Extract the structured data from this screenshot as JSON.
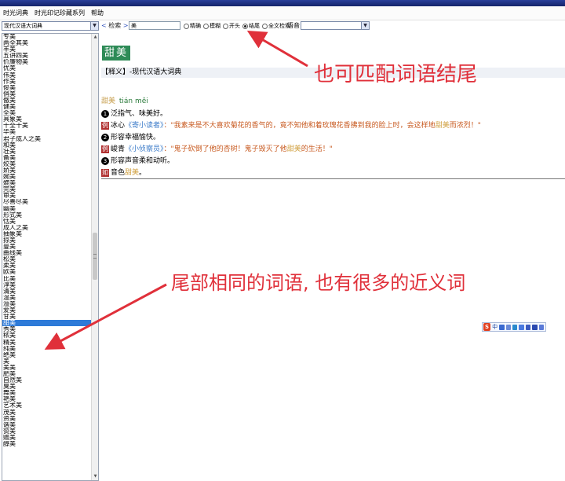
{
  "menu": [
    "时光词典",
    "时光印记珍藏系列",
    "帮助"
  ],
  "toolbar": {
    "dictionary": "现代汉语大词典",
    "search_label": "检索",
    "search_value": "美",
    "radios": [
      {
        "label": "精确",
        "checked": false
      },
      {
        "label": "模糊",
        "checked": false
      },
      {
        "label": "开头",
        "checked": false
      },
      {
        "label": "结尾",
        "checked": true
      },
      {
        "label": "全文检索",
        "checked": false
      }
    ],
    "voice_label": "语音"
  },
  "word_list": [
    "专美",
    "两全其美",
    "丰美",
    "五讲四美",
    "价廉物美",
    "优美",
    "伟美",
    "作美",
    "俊美",
    "俏美",
    "傲美",
    "健美",
    "全美",
    "具象美",
    "十全十美",
    "华美",
    "君子成人之美",
    "和美",
    "壮美",
    "备美",
    "姣美",
    "娇美",
    "婉美",
    "媲美",
    "完美",
    "审美",
    "尽善尽美",
    "幽美",
    "形式美",
    "恬美",
    "成人之美",
    "抽象美",
    "掠美",
    "曼美",
    "曲线美",
    "松美",
    "柔美",
    "欧美",
    "比美",
    "淳美",
    "清美",
    "温美",
    "溢美",
    "爱美",
    "甘美",
    "甜美",
    "秀美",
    "秾美",
    "精美",
    "纯美",
    "绝美",
    "美",
    "美美",
    "肥美",
    "自然美",
    "臭美",
    "舞美",
    "艳美",
    "艺术美",
    "茂美",
    "资美",
    "谐美",
    "赞美",
    "赡美",
    "醇美"
  ],
  "selected_word": "甜美",
  "entry": {
    "headword": "甜美",
    "source_tag": "【释义】",
    "source_text": "-现代汉语大词典",
    "word": "甜美",
    "pinyin": "tián měi",
    "sense1_num": "❶",
    "sense1": "泛指气、味美好。",
    "ex_tag": "例",
    "ex1_author": "冰心",
    "ex1_book": "《寄小读者》",
    "ex1_pre": "：\"我素来是不大喜欢菊花的香气的，竟不知他和着玫瑰花香拂到我的脸上时，会这样地",
    "ex1_hl": "甜美",
    "ex1_post": "而浓烈！\"",
    "sense2_num": "❷",
    "sense2": "形容幸福愉快。",
    "ex2_author": "峻青",
    "ex2_book": "《小侦察员》",
    "ex2_pre": "：\"鬼子砍倒了他的杏树！鬼子毁灭了他",
    "ex2_hl": "甜美",
    "ex2_post": "的生活！\"",
    "sense3_num": "❸",
    "sense3": "形容声音柔和动听。",
    "ru_tag": "如",
    "ex3_pre": "音色",
    "ex3_hl": "甜美",
    "ex3_post": "。"
  },
  "annotations": {
    "top": "也可匹配词语结尾",
    "bottom": "尾部相同的词语, 也有很多的近义词"
  },
  "ime": {
    "logo": "S",
    "text": "中"
  }
}
